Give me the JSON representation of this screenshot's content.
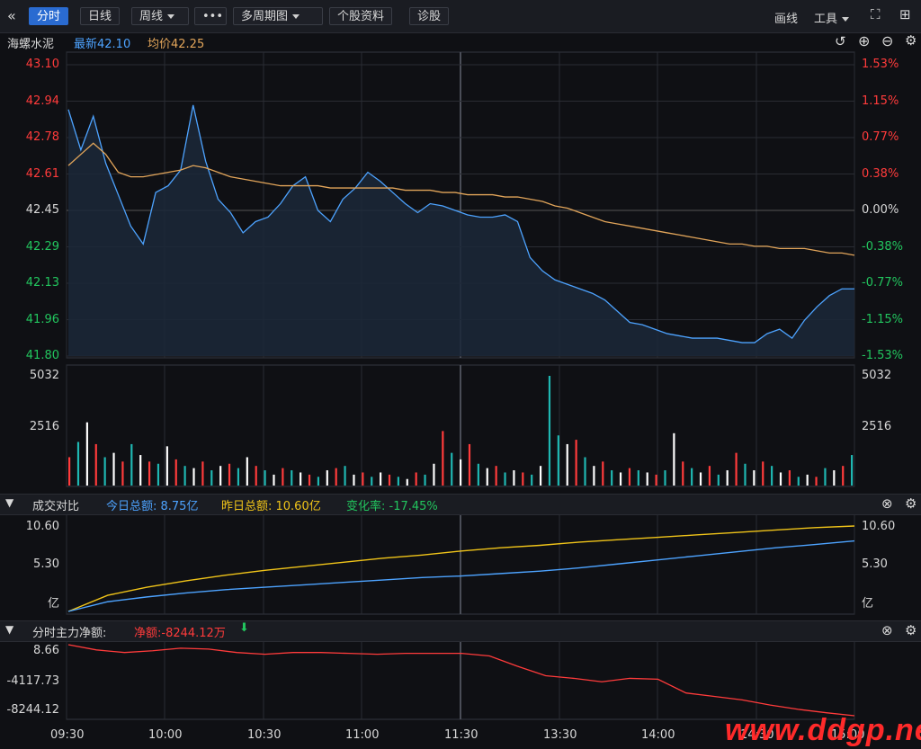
{
  "toolbar": {
    "back_icon": "double-chevron-left-icon",
    "tabs": [
      "分时",
      "日线",
      "周线"
    ],
    "more": "•••",
    "multi_period": "多周期图",
    "stock_info": "个股资料",
    "diagnose": "诊股",
    "draw": "画线",
    "tools": "工具"
  },
  "info": {
    "name": "海螺水泥",
    "latest": "最新42.10",
    "avg": "均价42.25"
  },
  "price_axis": {
    "left": [
      "43.10",
      "42.94",
      "42.78",
      "42.61",
      "42.45",
      "42.29",
      "42.13",
      "41.96",
      "41.80"
    ],
    "right": [
      "1.53%",
      "1.15%",
      "0.77%",
      "0.38%",
      "0.00%",
      "-0.38%",
      "-0.77%",
      "-1.15%",
      "-1.53%"
    ]
  },
  "volume_axis": {
    "left": [
      "5032",
      "2516"
    ],
    "right": [
      "5032",
      "2516"
    ]
  },
  "compare_panel": {
    "title": "成交对比",
    "today": "今日总额: 8.75亿",
    "yesterday": "昨日总额: 10.60亿",
    "change": "变化率: -17.45%",
    "left_axis": [
      "10.60",
      "5.30",
      "亿"
    ],
    "right_axis": [
      "10.60",
      "5.30",
      "亿"
    ]
  },
  "flow_panel": {
    "title": "分时主力净额:",
    "net": "净额:-8244.12万",
    "left_axis": [
      "8.66",
      "-4117.73",
      "-8244.12"
    ]
  },
  "time_axis": [
    "09:30",
    "10:00",
    "10:30",
    "11:00",
    "11:30",
    "13:30",
    "14:00",
    "14:30",
    "15:00"
  ],
  "watermark": "www.ddgp.net",
  "colors": {
    "up": "#ff3b3b",
    "down": "#22c55e",
    "price": "#4da3ff",
    "avg": "#e2a55a",
    "yesterday": "#f0c419"
  },
  "chart_data": [
    {
      "type": "line",
      "title": "海螺水泥",
      "ylim": [
        41.8,
        43.1
      ],
      "series": [
        {
          "name": "最新",
          "values": [
            42.9,
            42.72,
            42.87,
            42.66,
            42.52,
            42.38,
            42.3,
            42.53,
            42.56,
            42.63,
            42.92,
            42.67,
            42.5,
            42.44,
            42.35,
            42.4,
            42.42,
            42.48,
            42.56,
            42.6,
            42.45,
            42.4,
            42.5,
            42.55,
            42.62,
            42.58,
            42.53,
            42.48,
            42.44,
            42.48,
            42.47,
            42.45,
            42.43,
            42.42,
            42.42,
            42.43,
            42.4,
            42.24,
            42.18,
            42.14,
            42.12,
            42.1,
            42.08,
            42.05,
            42.0,
            41.95,
            41.94,
            41.92,
            41.9,
            41.89,
            41.88,
            41.88,
            41.88,
            41.87,
            41.86,
            41.86,
            41.9,
            41.92,
            41.88,
            41.96,
            42.02,
            42.07,
            42.1,
            42.1
          ]
        },
        {
          "name": "均价",
          "values": [
            42.65,
            42.7,
            42.75,
            42.7,
            42.62,
            42.6,
            42.6,
            42.61,
            42.62,
            42.63,
            42.65,
            42.64,
            42.62,
            42.6,
            42.59,
            42.58,
            42.57,
            42.56,
            42.56,
            42.56,
            42.56,
            42.55,
            42.55,
            42.55,
            42.55,
            42.55,
            42.55,
            42.54,
            42.54,
            42.54,
            42.53,
            42.53,
            42.52,
            42.52,
            42.52,
            42.51,
            42.51,
            42.5,
            42.49,
            42.47,
            42.46,
            42.44,
            42.42,
            42.4,
            42.39,
            42.38,
            42.37,
            42.36,
            42.35,
            42.34,
            42.33,
            42.32,
            42.31,
            42.3,
            42.3,
            42.29,
            42.29,
            42.28,
            42.28,
            42.28,
            42.27,
            42.26,
            42.26,
            42.25
          ]
        }
      ]
    },
    {
      "type": "bar",
      "title": "",
      "ylim": [
        0,
        5032
      ],
      "values": [
        1300,
        2000,
        2900,
        1900,
        1300,
        1500,
        1100,
        1900,
        1400,
        1100,
        1000,
        1800,
        1200,
        900,
        800,
        1100,
        700,
        900,
        1000,
        800,
        1300,
        900,
        700,
        500,
        800,
        700,
        600,
        500,
        400,
        700,
        800,
        900,
        500,
        600,
        400,
        600,
        500,
        400,
        300,
        600,
        500,
        1000,
        2500,
        1500,
        1200,
        1900,
        1000,
        800,
        900,
        600,
        700,
        600,
        500,
        900,
        5032,
        2300,
        1900,
        2100,
        1300,
        900,
        1100,
        700,
        600,
        800,
        700,
        600,
        500,
        700,
        2400,
        1100,
        800,
        600,
        900,
        500,
        700,
        1500,
        1000,
        700,
        1100,
        900,
        600,
        700,
        400,
        500,
        400,
        800,
        700,
        900,
        1400
      ]
    },
    {
      "type": "line",
      "title": "成交对比",
      "ylim": [
        0,
        10.6
      ],
      "series": [
        {
          "name": "今日总额",
          "values": [
            0,
            1.2,
            1.8,
            2.3,
            2.7,
            3.0,
            3.3,
            3.6,
            3.9,
            4.2,
            4.4,
            4.7,
            5.0,
            5.4,
            5.9,
            6.4,
            6.9,
            7.4,
            7.9,
            8.3,
            8.75
          ]
        },
        {
          "name": "昨日总额",
          "values": [
            0,
            2.0,
            3.0,
            3.8,
            4.5,
            5.1,
            5.6,
            6.1,
            6.6,
            7.0,
            7.5,
            7.9,
            8.2,
            8.6,
            8.9,
            9.2,
            9.5,
            9.8,
            10.1,
            10.4,
            10.6
          ]
        }
      ]
    },
    {
      "type": "line",
      "title": "分时主力净额",
      "ylim": [
        -8244.12,
        8.66
      ],
      "series": [
        {
          "name": "净额",
          "values": [
            8.66,
            -600,
            -900,
            -700,
            -400,
            -500,
            -900,
            -1100,
            -900,
            -900,
            -1000,
            -1100,
            -1000,
            -1000,
            -1000,
            -1300,
            -2500,
            -3600,
            -3900,
            -4300,
            -3900,
            -4000,
            -5600,
            -6000,
            -6400,
            -7000,
            -7500,
            -7900,
            -8244.12
          ]
        }
      ]
    }
  ]
}
